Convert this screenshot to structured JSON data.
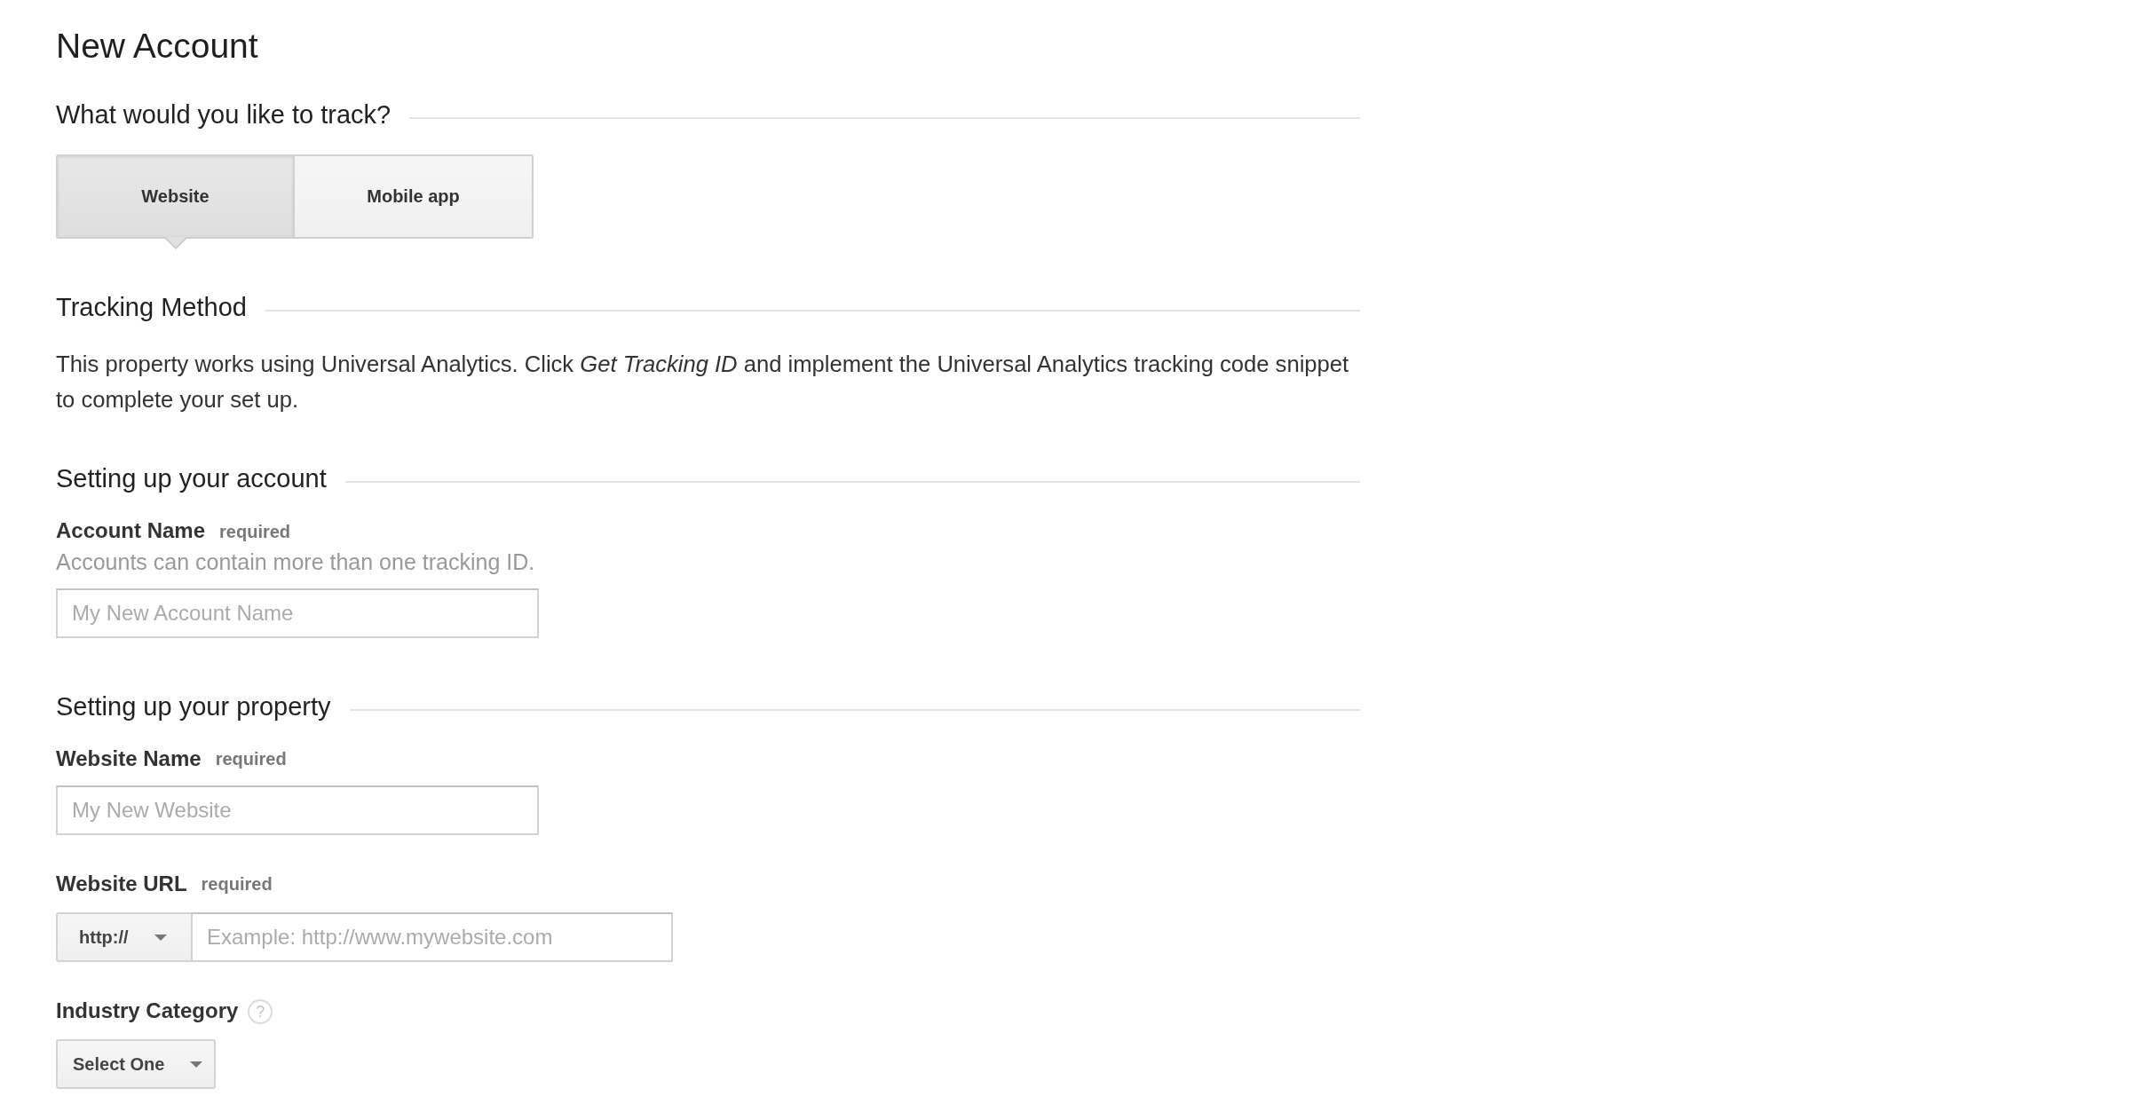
{
  "page_title": "New Account",
  "sections": [
    {
      "kind": "choice",
      "heading": "What would you like to track?",
      "options": [
        {
          "label": "Website",
          "selected": true
        },
        {
          "label": "Mobile app",
          "selected": false
        }
      ]
    },
    {
      "kind": "info",
      "heading": "Tracking Method",
      "text": "This property works using Universal Analytics. Click *Get Tracking ID* and implement the Universal Analytics tracking code snippet to complete your set up."
    },
    {
      "kind": "form",
      "heading": "Setting up your account",
      "fields": [
        {
          "kind": "text",
          "label": "Account Name",
          "tag": "required",
          "hint": "Accounts can contain more than one tracking ID.",
          "placeholder": "My New Account Name"
        }
      ]
    },
    {
      "kind": "form",
      "heading": "Setting up your property",
      "fields": [
        {
          "kind": "text",
          "label": "Website Name",
          "tag": "required",
          "placeholder": "My New Website"
        },
        {
          "kind": "url",
          "label": "Website URL",
          "tag": "required",
          "protocol": "http://",
          "placeholder": "Example: http://www.mywebsite.com"
        },
        {
          "kind": "select",
          "label": "Industry Category",
          "help": "?",
          "value": "Select One"
        }
      ]
    }
  ]
}
